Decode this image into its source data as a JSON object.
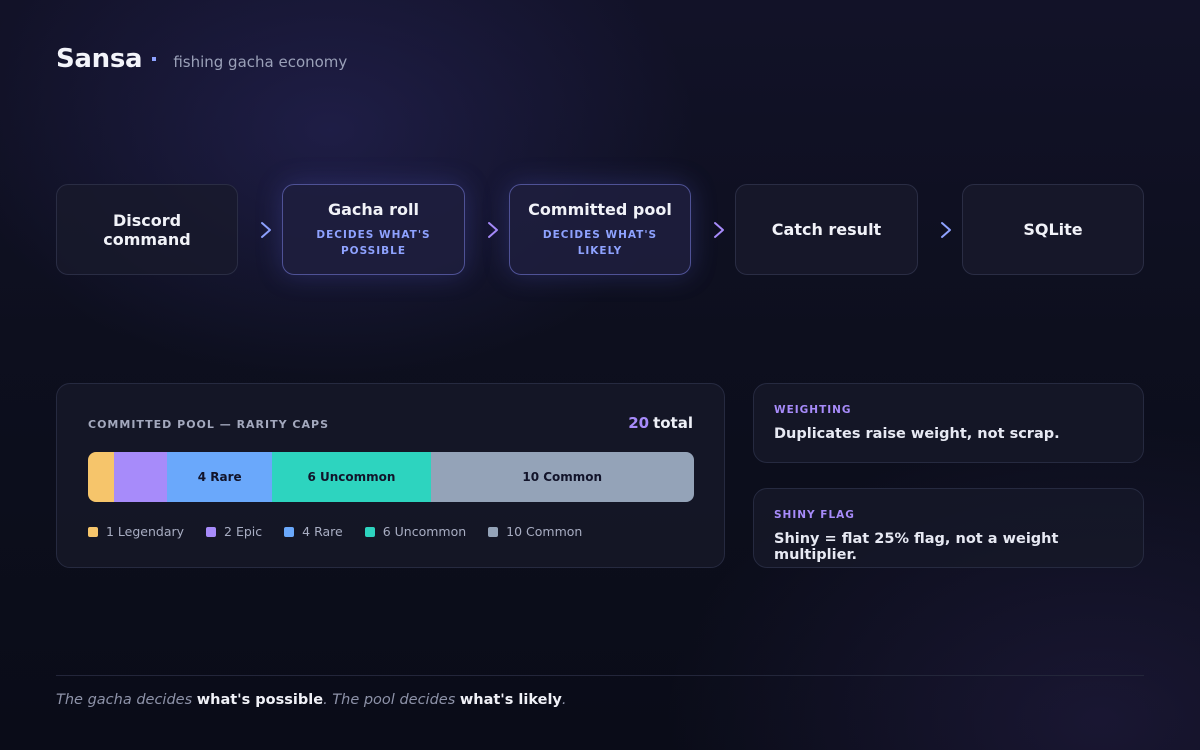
{
  "header": {
    "brand": "Sansa",
    "tagline": "fishing gacha economy"
  },
  "flow": {
    "nodes": [
      {
        "title": "Discord command",
        "subtitle": "",
        "highlight": false
      },
      {
        "title": "Gacha roll",
        "subtitle": "DECIDES WHAT'S POSSIBLE",
        "highlight": true
      },
      {
        "title": "Committed pool",
        "subtitle": "DECIDES WHAT'S LIKELY",
        "highlight": true
      },
      {
        "title": "Catch result",
        "subtitle": "",
        "highlight": false
      },
      {
        "title": "SQLite",
        "subtitle": "",
        "highlight": false
      }
    ],
    "arrow_colors": [
      "#8ea2ff",
      "#a78bfa",
      "#a78bfa",
      "#8ea2ff"
    ]
  },
  "pool": {
    "label": "COMMITTED POOL — RARITY CAPS",
    "total_value": "20",
    "total_word": "total",
    "segments": [
      {
        "value": 1,
        "bar_label": "",
        "legend": "1 Legendary",
        "color": "#f6c56b"
      },
      {
        "value": 2,
        "bar_label": "",
        "legend": "2 Epic",
        "color": "#a78bfa"
      },
      {
        "value": 4,
        "bar_label": "4 Rare",
        "legend": "4 Rare",
        "color": "#6aa8fb"
      },
      {
        "value": 6,
        "bar_label": "6 Uncommon",
        "legend": "6 Uncommon",
        "color": "#2dd4bf"
      },
      {
        "value": 10,
        "bar_label": "10 Common",
        "legend": "10 Common",
        "color": "#94a3b8"
      }
    ]
  },
  "weighting": {
    "label": "WEIGHTING",
    "text": "Duplicates raise weight, not scrap."
  },
  "shiny": {
    "label": "SHINY FLAG",
    "text": "Shiny = flat 25% flag, not a weight multiplier."
  },
  "footer": {
    "part1": "The gacha decides",
    "part2": "what's possible",
    "part3": ". The pool decides",
    "part4": "what's likely",
    "part5": "."
  }
}
